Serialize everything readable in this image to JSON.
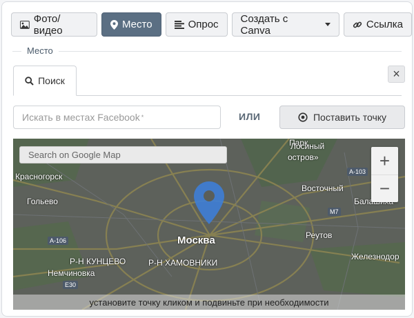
{
  "toolbar": {
    "photo_label": "Фото/видео",
    "place_label": "Место",
    "poll_label": "Опрос",
    "canva_label": "Создать с Canva",
    "link_label": "Ссылка"
  },
  "section": {
    "legend": "Место",
    "close_label": "×"
  },
  "search_tab": {
    "label": "Поиск"
  },
  "facebook_search": {
    "placeholder": "Искать в местах Facebook",
    "required_mark": "*"
  },
  "or_label": "ИЛИ",
  "set_point_button": "Поставить точку",
  "map": {
    "search_placeholder": "Search on Google Map",
    "zoom_in": "+",
    "zoom_out": "−",
    "hint": "установите точку кликом и подвиньте при необходимости",
    "labels": {
      "krasnogorsk": "Красногорск",
      "golyevo": "Гольево",
      "moskva": "Москва",
      "kuntsevo": "Р-Н КУНЦЕВО",
      "khamovniki": "Р-Н ХАМОВНИКИ",
      "nemchinovka": "Немчиновка",
      "reutov": "Реутов",
      "balashikha": "Балашиха",
      "vostochny": "Восточный",
      "zheleznodor": "Железнодор",
      "park1": "Парк",
      "park2": "Лосиный",
      "park3": "остров»"
    },
    "shields": {
      "a103": "A-103",
      "a106": "A-106",
      "m7": "M7",
      "e30": "E30"
    },
    "colors": {
      "pin": "#3e7ed6",
      "overlay": "#5a5e58"
    }
  }
}
